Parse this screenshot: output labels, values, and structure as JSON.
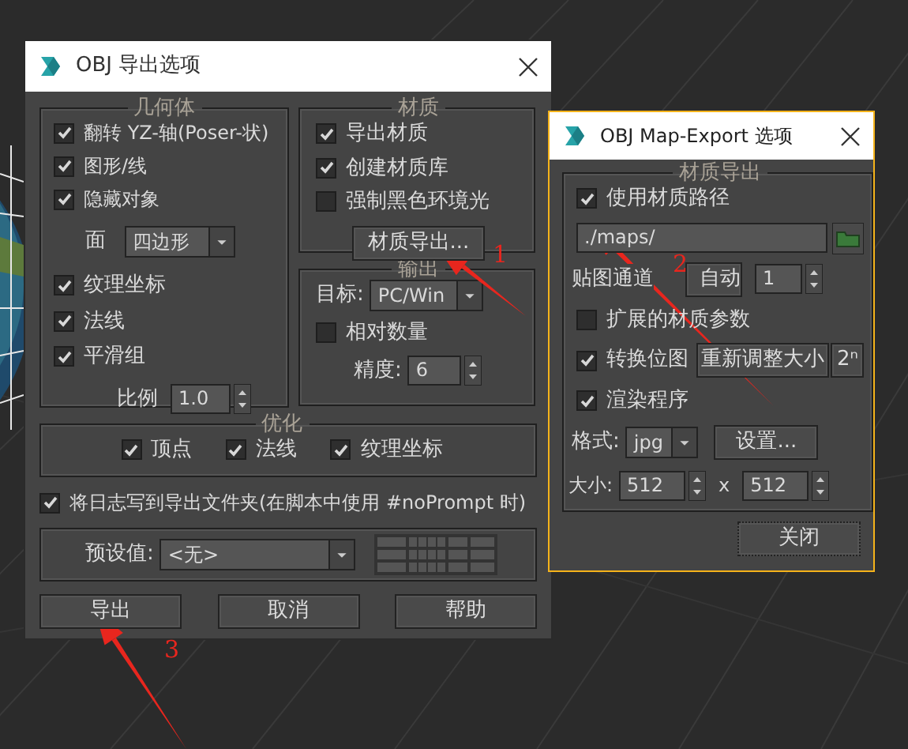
{
  "main_dialog": {
    "title": "OBJ 导出选项",
    "geometry": {
      "title": "几何体",
      "checkboxes_top": [
        {
          "label": "翻转 YZ-轴(Poser-状)",
          "checked": true
        },
        {
          "label": "图形/线",
          "checked": true
        },
        {
          "label": "隐藏对象",
          "checked": true
        }
      ],
      "face_label": "面",
      "face_value": "四边形",
      "checkboxes_bottom": [
        {
          "label": "纹理坐标",
          "checked": true
        },
        {
          "label": "法线",
          "checked": true
        },
        {
          "label": "平滑组",
          "checked": true
        }
      ],
      "scale_label": "比例",
      "scale_value": "1.0"
    },
    "material": {
      "title": "材质",
      "checkboxes": [
        {
          "label": "导出材质",
          "checked": true
        },
        {
          "label": "创建材质库",
          "checked": true
        },
        {
          "label": "强制黑色环境光",
          "checked": false
        }
      ],
      "button": "材质导出..."
    },
    "output": {
      "title": "输出",
      "target_label": "目标:",
      "target_value": "PC/Win",
      "checkbox": {
        "label": "相对数量",
        "checked": false
      },
      "precision_label": "精度:",
      "precision_value": "6"
    },
    "optimize": {
      "title": "优化",
      "checkboxes": [
        {
          "label": "顶点",
          "checked": true
        },
        {
          "label": "法线",
          "checked": true
        },
        {
          "label": "纹理坐标",
          "checked": true
        }
      ]
    },
    "log_checkbox": {
      "label": "将日志写到导出文件夹(在脚本中使用 #noPrompt 时)",
      "checked": true
    },
    "preset": {
      "label": "预设值:",
      "value": "<无>"
    },
    "buttons": [
      "导出",
      "取消",
      "帮助"
    ]
  },
  "map_dialog": {
    "title": "OBJ Map-Export 选项",
    "group_title": "材质导出",
    "use_path": {
      "label": "使用材质路径",
      "checked": true
    },
    "path_value": "./maps/",
    "channel_label": "贴图通道",
    "auto_button": "自动",
    "channel_value": "1",
    "extended": {
      "label": "扩展的材质参数",
      "checked": false
    },
    "convert": {
      "label": "转换位图",
      "checked": true
    },
    "resize_button": "重新调整大小",
    "pow2_button": "2ⁿ",
    "renderer": {
      "label": "渲染程序",
      "checked": true
    },
    "format_label": "格式:",
    "format_value": "jpg",
    "settings_button": "设置...",
    "size_label": "大小:",
    "width_value": "512",
    "times": "x",
    "height_value": "512",
    "close_button": "关闭"
  },
  "annotations": [
    "1",
    "2",
    "3"
  ]
}
